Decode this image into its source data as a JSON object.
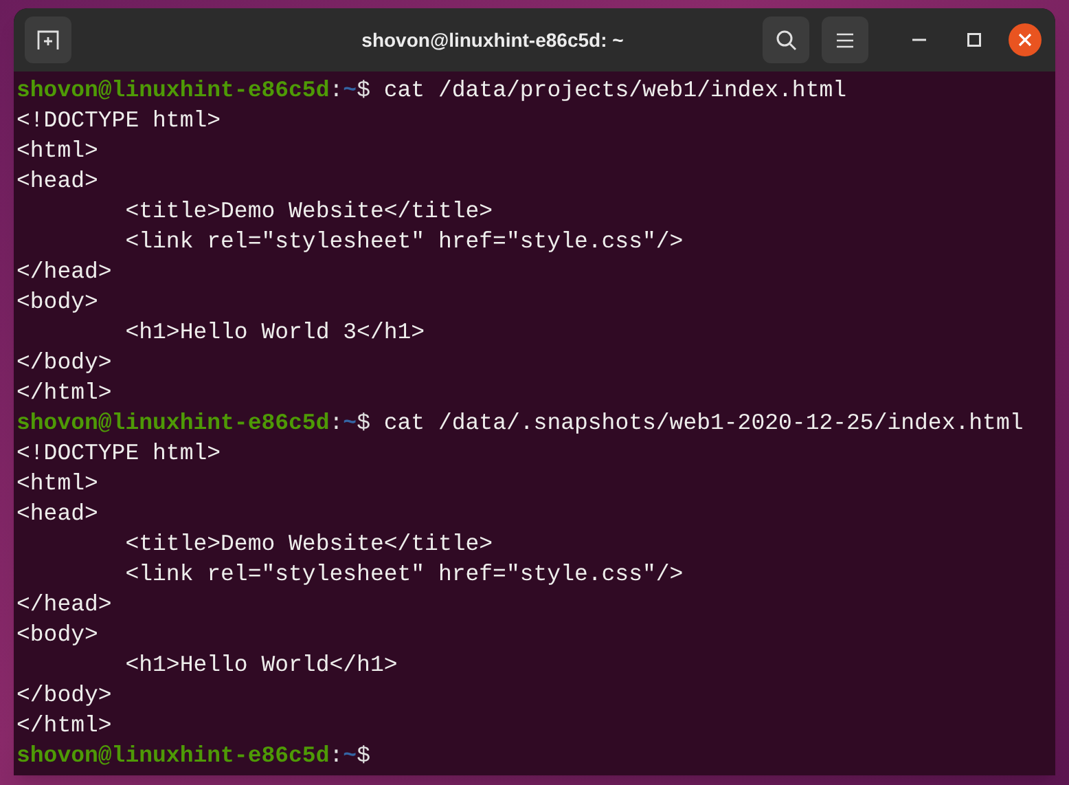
{
  "window": {
    "title": "shovon@linuxhint-e86c5d: ~"
  },
  "terminal": {
    "lines": [
      {
        "kind": "prompt",
        "user": "shovon@linuxhint-e86c5d",
        "separator": ":",
        "path": "~",
        "symbol": "$",
        "command": " cat /data/projects/web1/index.html"
      },
      {
        "kind": "output",
        "text": "<!DOCTYPE html>"
      },
      {
        "kind": "output",
        "text": "<html>"
      },
      {
        "kind": "output",
        "text": "<head>"
      },
      {
        "kind": "output",
        "text": "        <title>Demo Website</title>"
      },
      {
        "kind": "output",
        "text": "        <link rel=\"stylesheet\" href=\"style.css\"/>"
      },
      {
        "kind": "output",
        "text": "</head>"
      },
      {
        "kind": "output",
        "text": "<body>"
      },
      {
        "kind": "output",
        "text": "        <h1>Hello World 3</h1>"
      },
      {
        "kind": "output",
        "text": "</body>"
      },
      {
        "kind": "output",
        "text": "</html>"
      },
      {
        "kind": "prompt",
        "user": "shovon@linuxhint-e86c5d",
        "separator": ":",
        "path": "~",
        "symbol": "$",
        "command": " cat /data/.snapshots/web1-2020-12-25/index.html"
      },
      {
        "kind": "output",
        "text": "<!DOCTYPE html>"
      },
      {
        "kind": "output",
        "text": "<html>"
      },
      {
        "kind": "output",
        "text": "<head>"
      },
      {
        "kind": "output",
        "text": "        <title>Demo Website</title>"
      },
      {
        "kind": "output",
        "text": "        <link rel=\"stylesheet\" href=\"style.css\"/>"
      },
      {
        "kind": "output",
        "text": "</head>"
      },
      {
        "kind": "output",
        "text": "<body>"
      },
      {
        "kind": "output",
        "text": "        <h1>Hello World</h1>"
      },
      {
        "kind": "output",
        "text": "</body>"
      },
      {
        "kind": "output",
        "text": "</html>"
      },
      {
        "kind": "prompt",
        "user": "shovon@linuxhint-e86c5d",
        "separator": ":",
        "path": "~",
        "symbol": "$"
      }
    ]
  }
}
